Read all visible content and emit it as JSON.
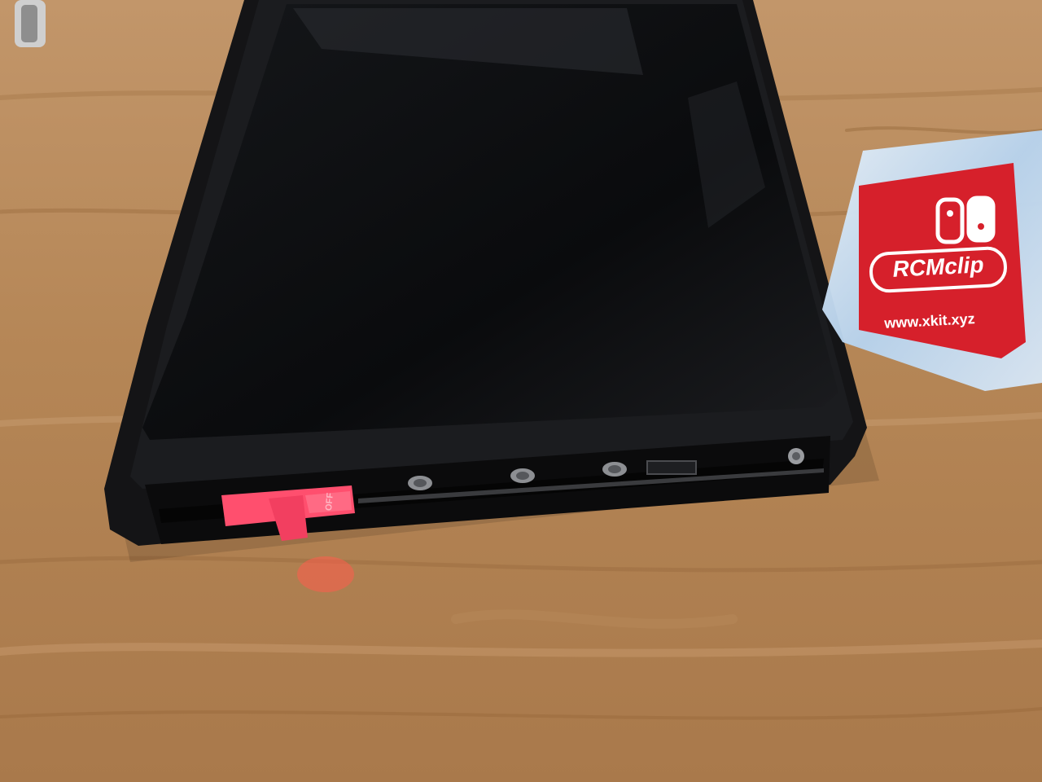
{
  "photo": {
    "colors": {
      "table": "#b88a5c",
      "table_dark": "#8e6238",
      "table_light": "#d2a577",
      "console_body": "#141416",
      "console_screen": "#0d0e10",
      "rcm_clip": "#ff4f6e",
      "case_plastic": "#c9def3",
      "case_label": "#d6202b"
    },
    "objects": {
      "console": {
        "name": "handheld console (bottom edge, joy-con rail visible)"
      },
      "clip": {
        "name": "RCM jig inserted in right rail",
        "tab_text": "OFF"
      },
      "case": {
        "logo_icon": "switch-logo-icon",
        "brand_text": "RCMclip",
        "url_text": "www.xkit.xyz"
      }
    }
  }
}
